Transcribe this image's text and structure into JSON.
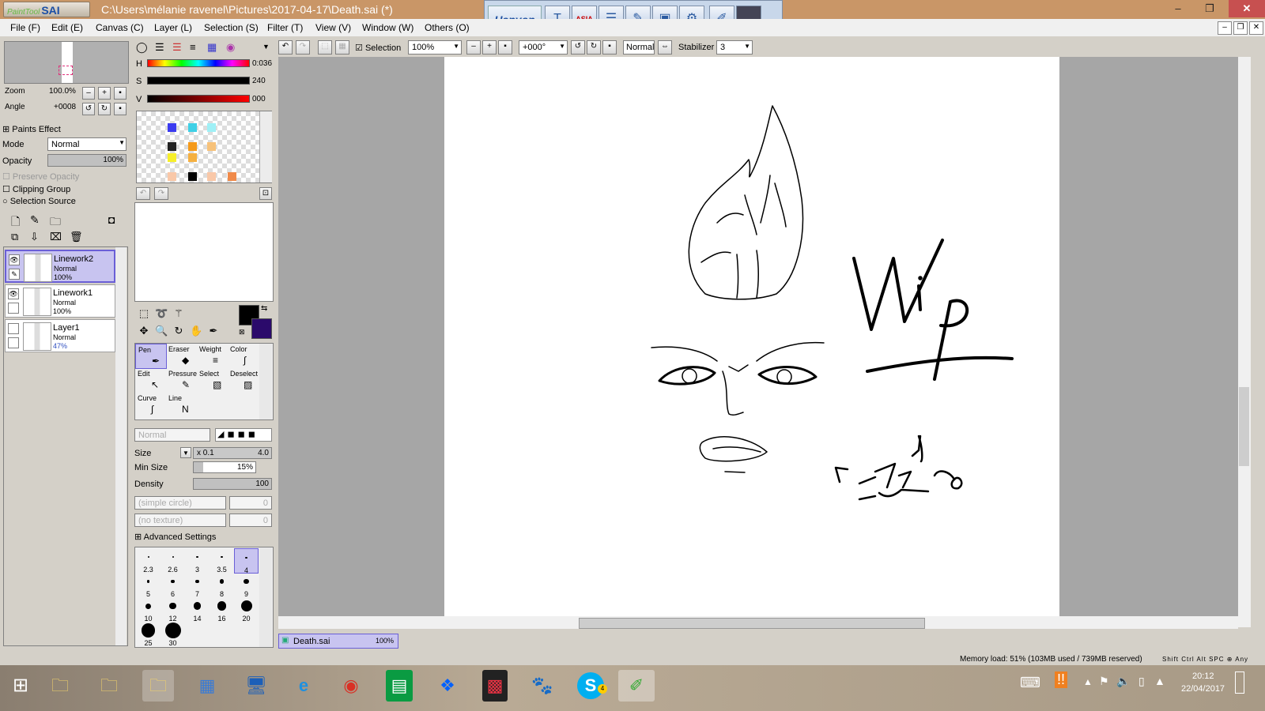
{
  "window": {
    "app_name": "SAI",
    "app_prefix": "PaintTool",
    "title": "C:\\Users\\mélanie ravenel\\Pictures\\2017-04-17\\Death.sai (*)",
    "ime_brand": "Hanvon",
    "ime_asia": "ASIA"
  },
  "menu": {
    "items": [
      "File (F)",
      "Edit (E)",
      "Canvas (C)",
      "Layer (L)",
      "Selection (S)",
      "Filter (T)",
      "View (V)",
      "Window (W)",
      "Others (O)"
    ]
  },
  "toolbar": {
    "selection_label": "Selection",
    "selection_checked": true,
    "zoom_value": "100%",
    "angle_value": "+000°",
    "blend_mode": "Normal",
    "stabilizer_label": "Stabilizer",
    "stabilizer_value": "3"
  },
  "navigator": {
    "zoom_label": "Zoom",
    "zoom_value": "100.0%",
    "angle_label": "Angle",
    "angle_value": "+0008"
  },
  "layer_props": {
    "paints_effect_label": "Paints Effect",
    "mode_label": "Mode",
    "mode_value": "Normal",
    "opacity_label": "Opacity",
    "opacity_value": "100%",
    "opacity_level": 1.0,
    "preserve_opacity_label": "Preserve Opacity",
    "clipping_group_label": "Clipping Group",
    "selection_source_label": "Selection Source"
  },
  "layers": [
    {
      "name": "Linework2",
      "mode": "Normal",
      "opacity": "100%",
      "visible": true,
      "selected": true
    },
    {
      "name": "Linework1",
      "mode": "Normal",
      "opacity": "100%",
      "visible": true,
      "selected": false
    },
    {
      "name": "Layer1",
      "mode": "Normal",
      "opacity": "47%",
      "visible": false,
      "selected": false
    }
  ],
  "color": {
    "h_label": "H",
    "h_value": "0:036",
    "s_label": "S",
    "s_value": "240",
    "v_label": "V",
    "v_value": "000",
    "primary": "#000000",
    "secondary": "#2b0a6b",
    "swatches": [
      "#3b3bf0",
      "#3fd0e6",
      "#9ff0f6",
      "#222222",
      "#f59a1a",
      "#f7c27a",
      "#f7ef2a",
      "#f5b040",
      "#f9c8a8",
      "#000000",
      "#f9c8a8",
      "#f08a4a"
    ]
  },
  "tools": {
    "cells": [
      "Pen",
      "Eraser",
      "Weight",
      "Color",
      "Edit",
      "Pressure",
      "Select",
      "Deselect",
      "Curve",
      "Line"
    ],
    "selected": "Pen"
  },
  "brush": {
    "mode": "Normal",
    "size_label": "Size",
    "size_multiplier": "x 0.1",
    "size_value": "4.0",
    "min_size_label": "Min Size",
    "min_size_value": "15%",
    "min_size_level": 0.15,
    "density_label": "Density",
    "density_value": "100",
    "density_level": 1.0,
    "shape_value": "(simple circle)",
    "shape_amount": "0",
    "texture_value": "(no texture)",
    "texture_amount": "0",
    "advanced_label": "Advanced Settings",
    "sizes": [
      "2.3",
      "2.6",
      "3",
      "3.5",
      "4",
      "5",
      "6",
      "7",
      "8",
      "9",
      "10",
      "12",
      "14",
      "16",
      "20",
      "25",
      "30"
    ],
    "selected_size": "4"
  },
  "document": {
    "tab_name": "Death.sai",
    "tab_zoom": "100%",
    "canvas_text": "Wip"
  },
  "status": {
    "memory": "Memory load: 51% (103MB used / 739MB reserved)",
    "keys": [
      "Shift",
      "Ctrl",
      "Alt",
      "SPC",
      "Any"
    ]
  },
  "taskbar": {
    "time": "20:12",
    "date": "22/04/2017",
    "skype_badge": "4"
  }
}
